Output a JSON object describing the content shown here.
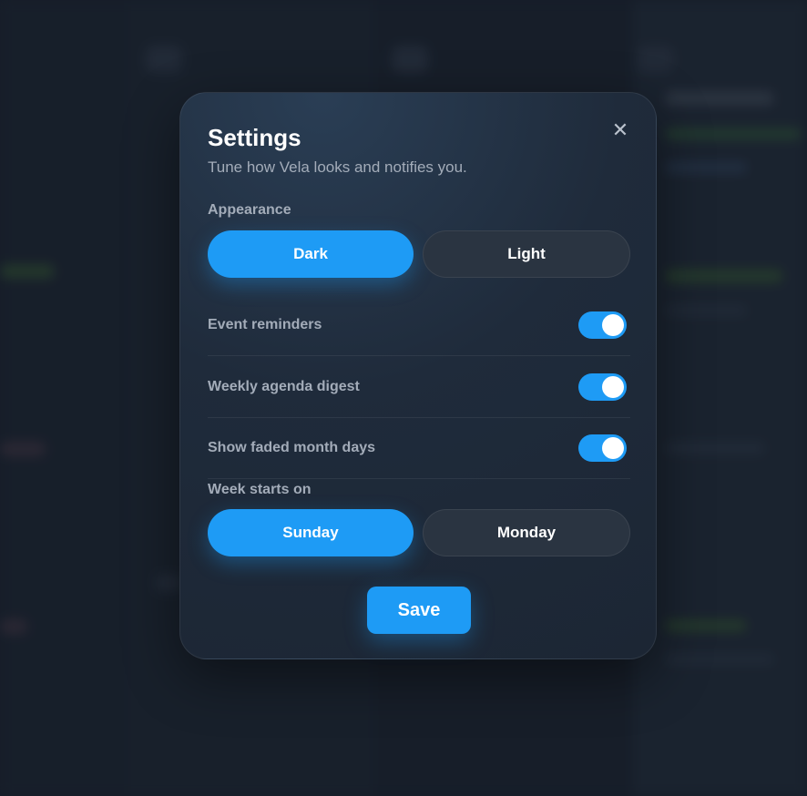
{
  "settings": {
    "title": "Settings",
    "subtitle": "Tune how Vela looks and notifies you.",
    "close_icon": "close-icon",
    "appearance": {
      "label": "Appearance",
      "options": [
        "Dark",
        "Light"
      ],
      "selected": "Dark"
    },
    "toggles": [
      {
        "label": "Event reminders",
        "on": true
      },
      {
        "label": "Weekly agenda digest",
        "on": true
      },
      {
        "label": "Show faded month days",
        "on": true
      }
    ],
    "week_start": {
      "label": "Week starts on",
      "options": [
        "Sunday",
        "Monday"
      ],
      "selected": "Sunday"
    },
    "save_label": "Save"
  },
  "colors": {
    "accent": "#1e9bf5",
    "modal_bg": "#1f2b3b",
    "inactive_button": "#2a3441",
    "label_text": "#a3acb9"
  }
}
